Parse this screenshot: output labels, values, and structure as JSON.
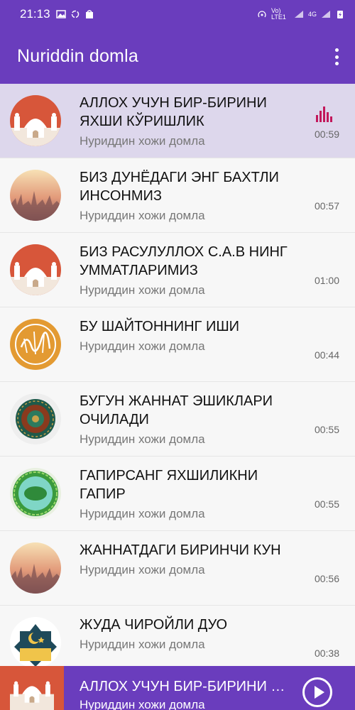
{
  "status": {
    "time": "21:13",
    "network_label": "Vo) LTE1",
    "network_type": "4G"
  },
  "app": {
    "title": "Nuriddin domla"
  },
  "colors": {
    "primary": "#6a3dbd",
    "active_row": "#ddd7ec",
    "equalizer": "#c2185b"
  },
  "tracks": [
    {
      "title": "АЛЛОХ УЧУН БИР-БИРИНИ ЯХШИ КЎРИШЛИК",
      "artist": "Нуриддин хожи домла",
      "duration": "00:59",
      "icon": "mosque-icon",
      "playing": true
    },
    {
      "title": "БИЗ ДУНЁДАГИ ЭНГ БАХТЛИ ИНСОНМИЗ",
      "artist": "Нуриддин хожи домла",
      "duration": "00:57",
      "icon": "city-sunset-icon",
      "playing": false
    },
    {
      "title": "БИЗ РАСУЛУЛЛОХ С.А.В НИНГ УММАТЛАРИМИЗ",
      "artist": "Нуриддин хожи домла",
      "duration": "01:00",
      "icon": "mosque-icon",
      "playing": false
    },
    {
      "title": "БУ ШАЙТОННИНГ ИШИ",
      "artist": "Нуриддин хожи домла",
      "duration": "00:44",
      "icon": "calligraphy-icon",
      "playing": false
    },
    {
      "title": "БУГУН ЖАННАТ ЭШИКЛАРИ ОЧИЛАДИ",
      "artist": "Нуриддин хожи домла",
      "duration": "00:55",
      "icon": "mandala-icon",
      "playing": false
    },
    {
      "title": "ГАПИРСАНГ ЯХШИЛИКНИ ГАПИР",
      "artist": "Нуриддин хожи домла",
      "duration": "00:55",
      "icon": "ornament-icon",
      "playing": false
    },
    {
      "title": "ЖАННАТДАГИ БИРИНЧИ КУН",
      "artist": "Нуриддин хожи домла",
      "duration": "00:56",
      "icon": "city-sunset-icon",
      "playing": false
    },
    {
      "title": "ЖУДА ЧИРОЙЛИ ДУО",
      "artist": "Нуриддин хожи домла",
      "duration": "00:38",
      "icon": "crescent-star-icon",
      "playing": false
    }
  ],
  "player": {
    "title": "АЛЛОХ УЧУН БИР-БИРИНИ ЯХШИ КЎРИШЛИК",
    "artist": "Нуриддин хожи домла",
    "icon": "mosque-icon",
    "play_icon": "play-icon"
  }
}
